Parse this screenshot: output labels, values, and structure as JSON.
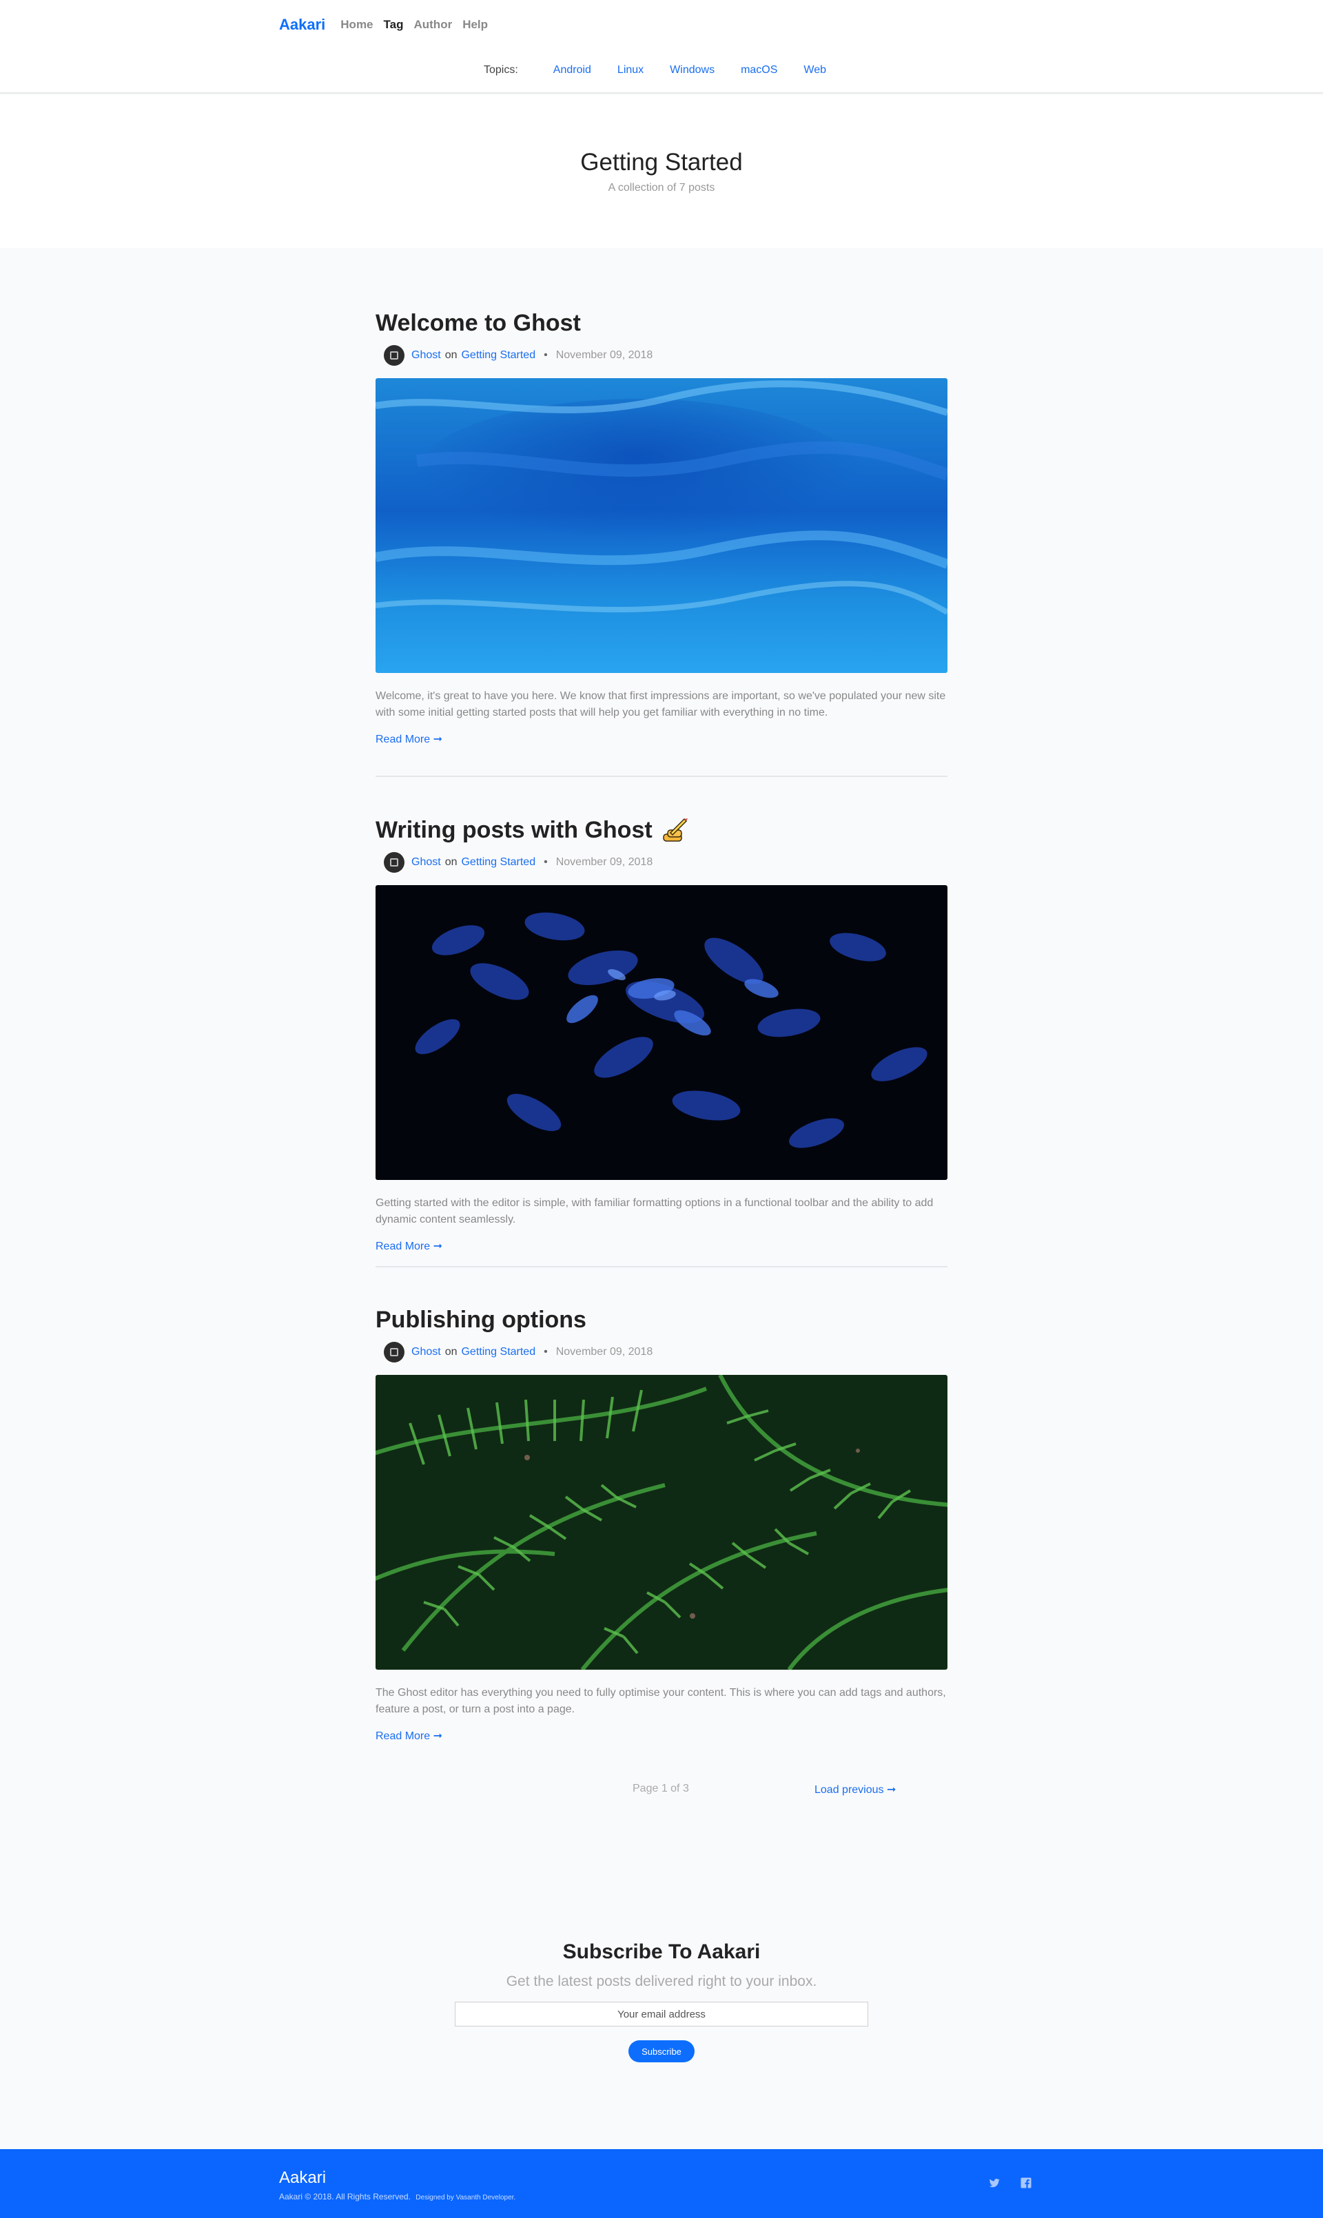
{
  "header": {
    "brand": "Aakari",
    "nav": [
      {
        "label": "Home",
        "active": false
      },
      {
        "label": "Tag",
        "active": true
      },
      {
        "label": "Author",
        "active": false
      },
      {
        "label": "Help",
        "active": false
      }
    ],
    "topics_label": "Topics:",
    "topics": [
      "Android",
      "Linux",
      "Windows",
      "macOS",
      "Web"
    ]
  },
  "hero": {
    "title": "Getting Started",
    "subtitle": "A collection of 7 posts"
  },
  "posts": [
    {
      "title": "Welcome to Ghost",
      "author": "Ghost",
      "on": "on",
      "tag": "Getting Started",
      "date": "November 09, 2018",
      "image": "blue-water-texture",
      "excerpt": "Welcome, it's great to have you here. We know that first impressions are important, so we've populated your new site with some initial getting started posts that will help you get familiar with everything in no time.",
      "read_more": "Read More ➞"
    },
    {
      "title": "Writing posts with Ghost",
      "author": "Ghost",
      "on": "on",
      "tag": "Getting Started",
      "date": "November 09, 2018",
      "image": "dark-blue-leaves",
      "excerpt": "Getting started with the editor is simple, with familiar formatting options in a functional toolbar and the ability to add dynamic content seamlessly.",
      "read_more": "Read More ➞"
    },
    {
      "title": "Publishing options",
      "author": "Ghost",
      "on": "on",
      "tag": "Getting Started",
      "date": "November 09, 2018",
      "image": "green-ferns",
      "excerpt": "The Ghost editor has everything you need to fully optimise your content. This is where you can add tags and authors, feature a post, or turn a post into a page.",
      "read_more": "Read More ➞"
    }
  ],
  "pagination": {
    "page_info": "Page 1 of 3",
    "load_previous": "Load previous ➞"
  },
  "subscribe": {
    "title": "Subscribe To Aakari",
    "description": "Get the latest posts delivered right to your inbox.",
    "placeholder": "Your email address",
    "button": "Subscribe"
  },
  "footer": {
    "brand": "Aakari",
    "copyright": "Aakari © 2018. All Rights Reserved.",
    "designed_by": "Designed by Vasanth Developer.",
    "social": [
      "twitter-icon",
      "facebook-icon"
    ]
  },
  "colors": {
    "accent": "#0d6efd",
    "link": "#1a6ef0",
    "footer_bg": "#0b66ff",
    "page_bg": "#f9fafc"
  }
}
